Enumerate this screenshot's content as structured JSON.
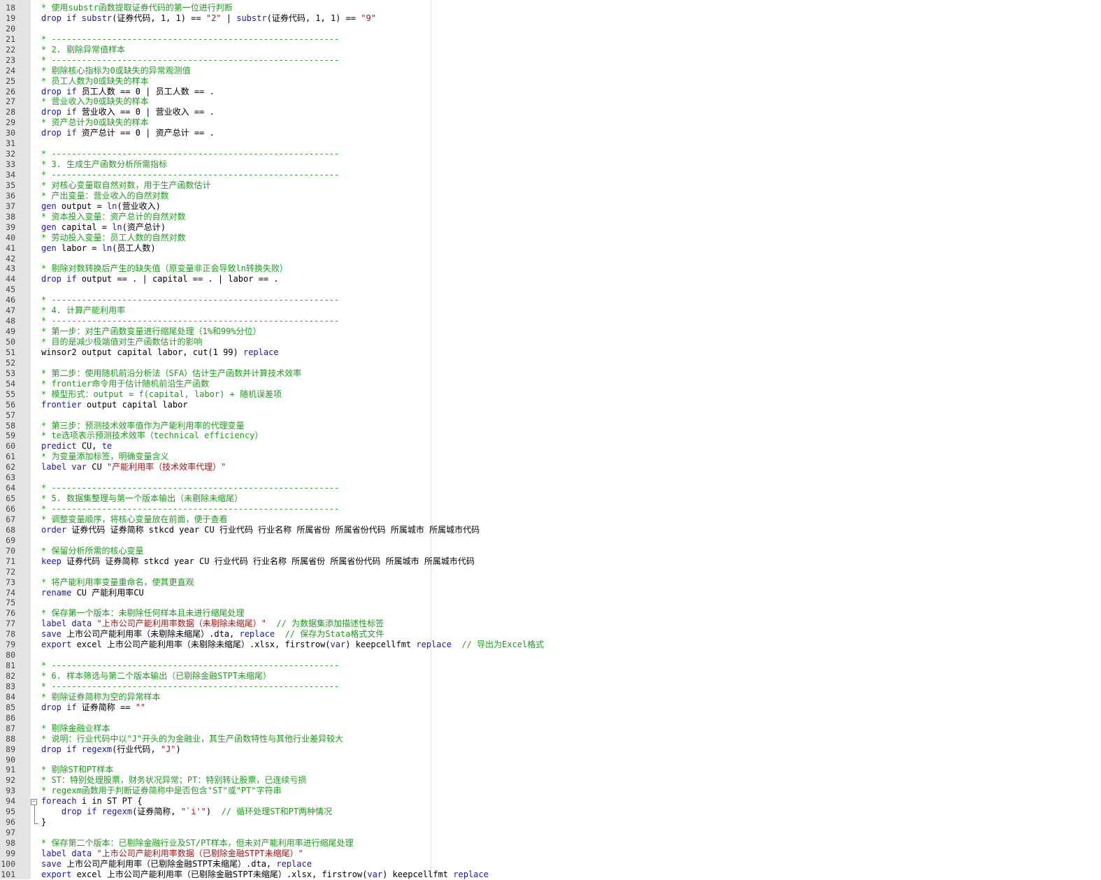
{
  "editor": {
    "lines": [
      {
        "n": "18",
        "s": [
          [
            "c",
            "* 使用substr函数提取证券代码的第一位进行判断"
          ]
        ]
      },
      {
        "n": "19",
        "s": [
          [
            "k",
            "drop if "
          ],
          [
            "k",
            "substr"
          ],
          [
            "p",
            "(证券代码, 1, 1) == "
          ],
          [
            "s",
            "\"2\""
          ],
          [
            "p",
            " | "
          ],
          [
            "k",
            "substr"
          ],
          [
            "p",
            "(证券代码, 1, 1) == "
          ],
          [
            "s",
            "\"9\""
          ]
        ]
      },
      {
        "n": "20",
        "s": []
      },
      {
        "n": "21",
        "s": [
          [
            "c",
            "* ---------------------------------------------------------"
          ]
        ]
      },
      {
        "n": "22",
        "s": [
          [
            "c",
            "* 2. 剔除异常值样本"
          ]
        ]
      },
      {
        "n": "23",
        "s": [
          [
            "c",
            "* ---------------------------------------------------------"
          ]
        ]
      },
      {
        "n": "24",
        "s": [
          [
            "c",
            "* 剔除核心指标为0或缺失的异常观测值"
          ]
        ]
      },
      {
        "n": "25",
        "s": [
          [
            "c",
            "* 员工人数为0或缺失的样本"
          ]
        ]
      },
      {
        "n": "26",
        "s": [
          [
            "k",
            "drop if "
          ],
          [
            "p",
            "员工人数 == 0 | 员工人数 == ."
          ]
        ]
      },
      {
        "n": "27",
        "s": [
          [
            "c",
            "* 营业收入为0或缺失的样本"
          ]
        ]
      },
      {
        "n": "28",
        "s": [
          [
            "k",
            "drop if "
          ],
          [
            "p",
            "营业收入 == 0 | 营业收入 == ."
          ]
        ]
      },
      {
        "n": "29",
        "s": [
          [
            "c",
            "* 资产总计为0或缺失的样本"
          ]
        ]
      },
      {
        "n": "30",
        "s": [
          [
            "k",
            "drop if "
          ],
          [
            "p",
            "资产总计 == 0 | 资产总计 == ."
          ]
        ]
      },
      {
        "n": "31",
        "s": []
      },
      {
        "n": "32",
        "s": [
          [
            "c",
            "* ---------------------------------------------------------"
          ]
        ]
      },
      {
        "n": "33",
        "s": [
          [
            "c",
            "* 3. 生成生产函数分析所需指标"
          ]
        ]
      },
      {
        "n": "34",
        "s": [
          [
            "c",
            "* ---------------------------------------------------------"
          ]
        ]
      },
      {
        "n": "35",
        "s": [
          [
            "c",
            "* 对核心变量取自然对数，用于生产函数估计"
          ]
        ]
      },
      {
        "n": "36",
        "s": [
          [
            "c",
            "* 产出变量：营业收入的自然对数"
          ]
        ]
      },
      {
        "n": "37",
        "s": [
          [
            "k",
            "gen "
          ],
          [
            "p",
            "output = "
          ],
          [
            "k",
            "ln"
          ],
          [
            "p",
            "(营业收入)"
          ]
        ]
      },
      {
        "n": "38",
        "s": [
          [
            "c",
            "* 资本投入变量：资产总计的自然对数"
          ]
        ]
      },
      {
        "n": "39",
        "s": [
          [
            "k",
            "gen "
          ],
          [
            "p",
            "capital = "
          ],
          [
            "k",
            "ln"
          ],
          [
            "p",
            "(资产总计)"
          ]
        ]
      },
      {
        "n": "40",
        "s": [
          [
            "c",
            "* 劳动投入变量：员工人数的自然对数"
          ]
        ]
      },
      {
        "n": "41",
        "s": [
          [
            "k",
            "gen "
          ],
          [
            "p",
            "labor = "
          ],
          [
            "k",
            "ln"
          ],
          [
            "p",
            "(员工人数)"
          ]
        ]
      },
      {
        "n": "42",
        "s": []
      },
      {
        "n": "43",
        "s": [
          [
            "c",
            "* 剔除对数转换后产生的缺失值（原变量非正会导致ln转换失败）"
          ]
        ]
      },
      {
        "n": "44",
        "s": [
          [
            "k",
            "drop if "
          ],
          [
            "p",
            "output == . | capital == . | labor == ."
          ]
        ]
      },
      {
        "n": "45",
        "s": []
      },
      {
        "n": "46",
        "s": [
          [
            "c",
            "* ---------------------------------------------------------"
          ]
        ]
      },
      {
        "n": "47",
        "s": [
          [
            "c",
            "* 4. 计算产能利用率"
          ]
        ]
      },
      {
        "n": "48",
        "s": [
          [
            "c",
            "* ---------------------------------------------------------"
          ]
        ]
      },
      {
        "n": "49",
        "s": [
          [
            "c",
            "* 第一步：对生产函数变量进行缩尾处理（1%和99%分位）"
          ]
        ]
      },
      {
        "n": "50",
        "s": [
          [
            "c",
            "* 目的是减少极端值对生产函数估计的影响"
          ]
        ]
      },
      {
        "n": "51",
        "s": [
          [
            "p",
            "winsor2 output capital labor, cut(1 99) "
          ],
          [
            "k",
            "replace"
          ]
        ]
      },
      {
        "n": "52",
        "s": []
      },
      {
        "n": "53",
        "s": [
          [
            "c",
            "* 第二步：使用随机前沿分析法（SFA）估计生产函数并计算技术效率"
          ]
        ]
      },
      {
        "n": "54",
        "s": [
          [
            "c",
            "* frontier命令用于估计随机前沿生产函数"
          ]
        ]
      },
      {
        "n": "55",
        "s": [
          [
            "c",
            "* 模型形式：output = f(capital, labor) + 随机误差项"
          ]
        ]
      },
      {
        "n": "56",
        "s": [
          [
            "k",
            "frontier "
          ],
          [
            "p",
            "output capital labor"
          ]
        ]
      },
      {
        "n": "57",
        "s": []
      },
      {
        "n": "58",
        "s": [
          [
            "c",
            "* 第三步：预测技术效率值作为产能利用率的代理变量"
          ]
        ]
      },
      {
        "n": "59",
        "s": [
          [
            "c",
            "* te选项表示预测技术效率（technical efficiency）"
          ]
        ]
      },
      {
        "n": "60",
        "s": [
          [
            "k",
            "predict "
          ],
          [
            "p",
            "CU, "
          ],
          [
            "k",
            "te"
          ]
        ]
      },
      {
        "n": "61",
        "s": [
          [
            "c",
            "* 为变量添加标签，明确变量含义"
          ]
        ]
      },
      {
        "n": "62",
        "s": [
          [
            "k",
            "label var "
          ],
          [
            "p",
            "CU "
          ],
          [
            "s",
            "\"产能利用率（技术效率代理）\""
          ]
        ]
      },
      {
        "n": "63",
        "s": []
      },
      {
        "n": "64",
        "s": [
          [
            "c",
            "* ---------------------------------------------------------"
          ]
        ]
      },
      {
        "n": "65",
        "s": [
          [
            "c",
            "* 5. 数据集整理与第一个版本输出（未剔除未缩尾）"
          ]
        ]
      },
      {
        "n": "66",
        "s": [
          [
            "c",
            "* ---------------------------------------------------------"
          ]
        ]
      },
      {
        "n": "67",
        "s": [
          [
            "c",
            "* 调整变量顺序，将核心变量放在前面，便于查看"
          ]
        ]
      },
      {
        "n": "68",
        "s": [
          [
            "k",
            "order "
          ],
          [
            "p",
            "证券代码 证券简称 stkcd year CU 行业代码 行业名称 所属省份 所属省份代码 所属城市 所属城市代码"
          ]
        ]
      },
      {
        "n": "69",
        "s": []
      },
      {
        "n": "70",
        "s": [
          [
            "c",
            "* 保留分析所需的核心变量"
          ]
        ]
      },
      {
        "n": "71",
        "s": [
          [
            "k",
            "keep "
          ],
          [
            "p",
            "证券代码 证券简称 stkcd year CU 行业代码 行业名称 所属省份 所属省份代码 所属城市 所属城市代码"
          ]
        ]
      },
      {
        "n": "72",
        "s": []
      },
      {
        "n": "73",
        "s": [
          [
            "c",
            "* 将产能利用率变量重命名，使其更直观"
          ]
        ]
      },
      {
        "n": "74",
        "s": [
          [
            "k",
            "rename "
          ],
          [
            "p",
            "CU 产能利用率CU"
          ]
        ]
      },
      {
        "n": "75",
        "s": []
      },
      {
        "n": "76",
        "s": [
          [
            "c",
            "* 保存第一个版本：未剔除任何样本且未进行缩尾处理"
          ]
        ]
      },
      {
        "n": "77",
        "s": [
          [
            "k",
            "label data "
          ],
          [
            "s",
            "\"上市公司产能利用率数据（未剔除未缩尾）\""
          ],
          [
            "p",
            "  "
          ],
          [
            "c",
            "// 为数据集添加描述性标签"
          ]
        ]
      },
      {
        "n": "78",
        "s": [
          [
            "k",
            "save "
          ],
          [
            "p",
            "上市公司产能利用率（未剔除未缩尾）.dta, "
          ],
          [
            "k",
            "replace"
          ],
          [
            "p",
            "  "
          ],
          [
            "c",
            "// 保存为Stata格式文件"
          ]
        ]
      },
      {
        "n": "79",
        "s": [
          [
            "k",
            "export "
          ],
          [
            "p",
            "excel 上市公司产能利用率（未剔除未缩尾）.xlsx, firstrow("
          ],
          [
            "k",
            "var"
          ],
          [
            "p",
            ") keepcellfmt "
          ],
          [
            "k",
            "replace"
          ],
          [
            "p",
            "  "
          ],
          [
            "c",
            "// 导出为Excel格式"
          ]
        ]
      },
      {
        "n": "80",
        "s": []
      },
      {
        "n": "81",
        "s": [
          [
            "c",
            "* ---------------------------------------------------------"
          ]
        ]
      },
      {
        "n": "82",
        "s": [
          [
            "c",
            "* 6. 样本筛选与第二个版本输出（已剔除金融STPT未缩尾）"
          ]
        ]
      },
      {
        "n": "83",
        "s": [
          [
            "c",
            "* ---------------------------------------------------------"
          ]
        ]
      },
      {
        "n": "84",
        "s": [
          [
            "c",
            "* 剔除证券简称为空的异常样本"
          ]
        ]
      },
      {
        "n": "85",
        "s": [
          [
            "k",
            "drop if "
          ],
          [
            "p",
            "证券简称 == "
          ],
          [
            "s",
            "\"\""
          ]
        ]
      },
      {
        "n": "86",
        "s": []
      },
      {
        "n": "87",
        "s": [
          [
            "c",
            "* 剔除金融业样本"
          ]
        ]
      },
      {
        "n": "88",
        "s": [
          [
            "c",
            "* 说明：行业代码中以\"J\"开头的为金融业，其生产函数特性与其他行业差异较大"
          ]
        ]
      },
      {
        "n": "89",
        "s": [
          [
            "k",
            "drop if "
          ],
          [
            "k",
            "regexm"
          ],
          [
            "p",
            "(行业代码, "
          ],
          [
            "s",
            "\"J\""
          ],
          [
            "p",
            ")"
          ]
        ]
      },
      {
        "n": "90",
        "s": []
      },
      {
        "n": "91",
        "s": [
          [
            "c",
            "* 剔除ST和PT样本"
          ]
        ]
      },
      {
        "n": "92",
        "s": [
          [
            "c",
            "* ST：特别处理股票，财务状况异常；PT：特别转让股票，已连续亏损"
          ]
        ]
      },
      {
        "n": "93",
        "s": [
          [
            "c",
            "* regexm函数用于判断证券简称中是否包含\"ST\"或\"PT\"字符串"
          ]
        ]
      },
      {
        "n": "94",
        "s": [
          [
            "k",
            "foreach "
          ],
          [
            "p",
            "i in ST PT {"
          ]
        ]
      },
      {
        "n": "95",
        "s": [
          [
            "p",
            "    "
          ],
          [
            "k",
            "drop if "
          ],
          [
            "k",
            "regexm"
          ],
          [
            "p",
            "(证券简称, "
          ],
          [
            "s",
            "\"`i'\""
          ],
          [
            "p",
            ")  "
          ],
          [
            "c",
            "// 循环处理ST和PT两种情况"
          ]
        ]
      },
      {
        "n": "96",
        "s": [
          [
            "p",
            "}"
          ]
        ]
      },
      {
        "n": "97",
        "s": []
      },
      {
        "n": "98",
        "s": [
          [
            "c",
            "* 保存第二个版本：已剔除金融行业及ST/PT样本，但未对产能利用率进行缩尾处理"
          ]
        ]
      },
      {
        "n": "99",
        "s": [
          [
            "k",
            "label data "
          ],
          [
            "s",
            "\"上市公司产能利用率数据（已剔除金融STPT未缩尾）\""
          ]
        ]
      },
      {
        "n": "100",
        "s": [
          [
            "k",
            "save "
          ],
          [
            "p",
            "上市公司产能利用率（已剔除金融STPT未缩尾）.dta, "
          ],
          [
            "k",
            "replace"
          ]
        ]
      },
      {
        "n": "101",
        "s": [
          [
            "k",
            "export "
          ],
          [
            "p",
            "excel 上市公司产能利用率（已剔除金融STPT未缩尾）.xlsx, firstrow("
          ],
          [
            "k",
            "var"
          ],
          [
            "p",
            ") keepcellfmt "
          ],
          [
            "k",
            "replace"
          ]
        ]
      }
    ]
  },
  "colors": {
    "keyword": "#1a1aa6",
    "string": "#a31515",
    "comment": "#1e9b1e",
    "gutter": "#e4e4e4"
  },
  "icons": {
    "fold": "fold-minus-icon"
  }
}
